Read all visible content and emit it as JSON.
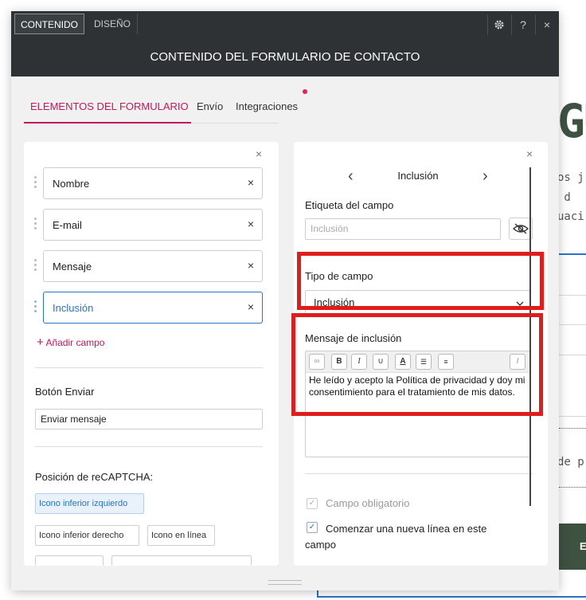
{
  "background": {
    "headline": "GU",
    "lines": [
      "os j",
      " d",
      "uaci",
      "de p"
    ],
    "button_letter": "E"
  },
  "topbar": {
    "tab_content": "CONTENIDO",
    "tab_design": "DISEÑO",
    "help": "?",
    "close": "×"
  },
  "title": "CONTENIDO DEL FORMULARIO DE CONTACTO",
  "nav": {
    "items": [
      "ELEMENTOS DEL FORMULARIO",
      "Envío",
      "Integraciones"
    ]
  },
  "left_panel": {
    "close": "×",
    "fields": [
      {
        "label": "Nombre",
        "remove": "×"
      },
      {
        "label": "E-mail",
        "remove": "×"
      },
      {
        "label": "Mensaje",
        "remove": "×"
      },
      {
        "label": "Inclusión",
        "remove": "×"
      }
    ],
    "add_field": "Añadir campo",
    "submit_section": "Botón Enviar",
    "submit_value": "Enviar mensaje",
    "recaptcha_section": "Posición de reCAPTCHA:",
    "recaptcha_options": [
      "Icono inferior izquierdo",
      "Icono inferior derecho",
      "Icono en línea"
    ]
  },
  "right_panel": {
    "close": "×",
    "field_nav_title": "Inclusión",
    "prev": "‹",
    "next": "›",
    "label_section": "Etiqueta del campo",
    "label_placeholder": "Inclusión",
    "type_section": "Tipo de campo",
    "type_value": "Inclusión",
    "message_section": "Mensaje de inclusión",
    "message_text": "He leído y acepto la Política de privacidad y doy mi consentimiento para el tratamiento de mis datos.",
    "required_label": "Campo obligatorio",
    "newline_label": "Comenzar una nueva línea en este campo"
  },
  "colors": {
    "accent": "#c2185b",
    "blue": "#2a73c7",
    "dark": "#2e3234",
    "highlight": "#e01c1c"
  }
}
